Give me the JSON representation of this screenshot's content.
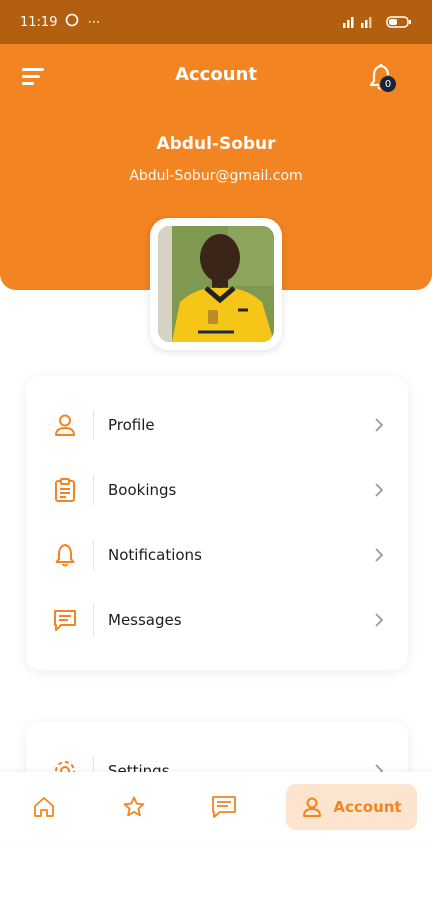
{
  "status_bar": {
    "time": "11:19",
    "extra": "⋯"
  },
  "header": {
    "title": "Account",
    "notification_count": "0"
  },
  "user": {
    "name": "Abdul-Sobur",
    "email": "Abdul-Sobur@gmail.com"
  },
  "menu": {
    "items": [
      {
        "label": "Profile",
        "icon": "person-icon"
      },
      {
        "label": "Bookings",
        "icon": "clipboard-icon"
      },
      {
        "label": "Notifications",
        "icon": "bell-icon"
      },
      {
        "label": "Messages",
        "icon": "message-icon"
      }
    ]
  },
  "menu_secondary": {
    "items": [
      {
        "label": "Settings",
        "icon": "settings-icon"
      }
    ]
  },
  "bottom_nav": {
    "account_label": "Account"
  },
  "colors": {
    "accent": "#f28422",
    "status_bar": "#b35f10",
    "badge": "#17243a",
    "active_tab_bg": "#fde4cf"
  }
}
